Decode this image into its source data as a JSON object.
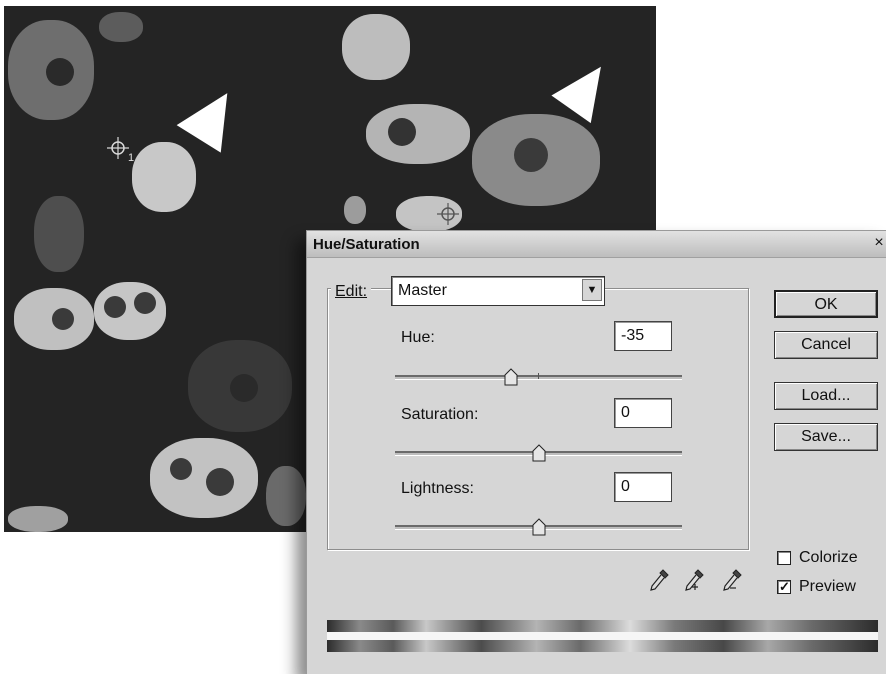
{
  "dialog": {
    "title": "Hue/Saturation",
    "close_glyph": "×",
    "edit": {
      "label": "Edit:",
      "value": "Master"
    },
    "hue": {
      "label": "Hue:",
      "value": "-35",
      "slider_value": -35,
      "slider_min": -180,
      "slider_max": 180
    },
    "saturation": {
      "label": "Saturation:",
      "value": "0",
      "slider_value": 0,
      "slider_min": -100,
      "slider_max": 100
    },
    "lightness": {
      "label": "Lightness:",
      "value": "0",
      "slider_value": 0,
      "slider_min": -100,
      "slider_max": 100
    },
    "buttons": {
      "ok": "OK",
      "cancel": "Cancel",
      "load": "Load...",
      "save": "Save..."
    },
    "colorize": {
      "label": "Colorize",
      "checked": false
    },
    "preview": {
      "label": "Preview",
      "checked": true
    },
    "eyedropper_icons": [
      "eyedropper-icon",
      "eyedropper-plus-icon",
      "eyedropper-minus-icon"
    ]
  },
  "image": {
    "crosshair_labels": [
      "1"
    ]
  }
}
